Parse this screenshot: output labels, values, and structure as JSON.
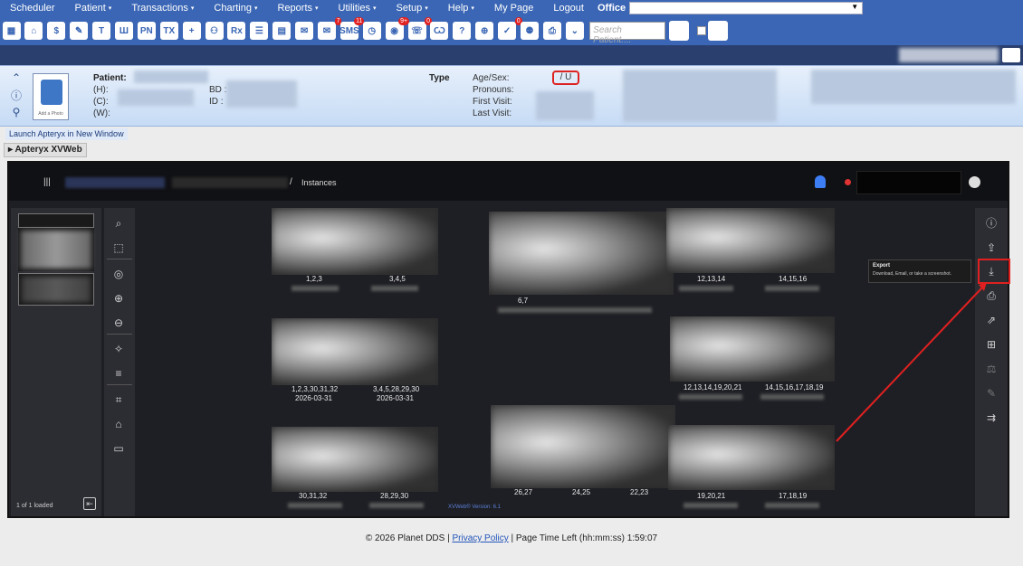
{
  "menu": {
    "items": [
      {
        "label": "Scheduler",
        "caret": ""
      },
      {
        "label": "Patient",
        "caret": "▾"
      },
      {
        "label": "Transactions",
        "caret": "▾"
      },
      {
        "label": "Charting",
        "caret": "▾"
      },
      {
        "label": "Reports",
        "caret": "▾"
      },
      {
        "label": "Utilities",
        "caret": "▾"
      },
      {
        "label": "Setup",
        "caret": "▾"
      },
      {
        "label": "Help",
        "caret": "▾"
      },
      {
        "label": "My Page",
        "caret": ""
      },
      {
        "label": "Logout",
        "caret": ""
      }
    ],
    "office_label": "Office"
  },
  "toolbar": {
    "icons": [
      {
        "name": "calendar-icon",
        "glyph": "▦",
        "badge": ""
      },
      {
        "name": "home-icon",
        "glyph": "⌂",
        "badge": ""
      },
      {
        "name": "dollar-icon",
        "glyph": "$",
        "badge": ""
      },
      {
        "name": "edit-icon",
        "glyph": "✎",
        "badge": ""
      },
      {
        "name": "tooth-icon",
        "glyph": "T",
        "badge": ""
      },
      {
        "name": "tooth-chart-icon",
        "glyph": "Ш",
        "badge": ""
      },
      {
        "name": "pn-icon",
        "glyph": "PN",
        "badge": ""
      },
      {
        "name": "tx-icon",
        "glyph": "TX",
        "badge": ""
      },
      {
        "name": "add-patient-icon",
        "glyph": "+",
        "badge": ""
      },
      {
        "name": "patients-icon",
        "glyph": "⚇",
        "badge": ""
      },
      {
        "name": "rx-icon",
        "glyph": "Rx",
        "badge": ""
      },
      {
        "name": "notes-icon",
        "glyph": "☰",
        "badge": ""
      },
      {
        "name": "document-icon",
        "glyph": "▤",
        "badge": ""
      },
      {
        "name": "mail-icon",
        "glyph": "✉",
        "badge": ""
      },
      {
        "name": "chat-icon",
        "glyph": "✉",
        "badge": "7"
      },
      {
        "name": "sms-icon",
        "glyph": "SMS",
        "badge": "11"
      },
      {
        "name": "clock-icon",
        "glyph": "◷",
        "badge": ""
      },
      {
        "name": "globe-icon",
        "glyph": "◉",
        "badge": "9+"
      },
      {
        "name": "recall-icon",
        "glyph": "☏",
        "badge": "0"
      },
      {
        "name": "tooth-outline-icon",
        "glyph": "Ѡ",
        "badge": ""
      },
      {
        "name": "question-icon",
        "glyph": "?",
        "badge": ""
      },
      {
        "name": "network-icon",
        "glyph": "⊕",
        "badge": ""
      },
      {
        "name": "tasks-icon",
        "glyph": "✓",
        "badge": "0"
      },
      {
        "name": "group-icon",
        "glyph": "⚉",
        "badge": ""
      },
      {
        "name": "printer-icon",
        "glyph": "⎙",
        "badge": ""
      },
      {
        "name": "chevron-icon",
        "glyph": "⌄",
        "badge": ""
      }
    ],
    "search_placeholder": "Search Patient...."
  },
  "patient": {
    "patient_label": "Patient:",
    "h_label": "(H):",
    "c_label": "(C):",
    "w_label": "(W):",
    "bd_label": "BD :",
    "id_label": "ID :",
    "type_label": "Type",
    "agesex_label": "Age/Sex:",
    "agesex_value": "/ U",
    "pronouns_label": "Pronouns:",
    "first_visit_label": "First Visit:",
    "last_visit_label": "Last Visit:",
    "photo_caption": "Add a Photo"
  },
  "launch_link": "Launch Apteryx in New Window",
  "section_tab": "Apteryx XVWeb",
  "viewer": {
    "breadcrumb_sep": "/",
    "breadcrumb_current": "Instances",
    "loaded_text": "1 of 1 loaded",
    "tiles": [
      {
        "labels": [
          "1,2,3",
          "3,4,5"
        ]
      },
      {
        "labels": [
          "6,7"
        ]
      },
      {
        "labels": [
          "12,13,14",
          "14,15,16"
        ]
      },
      {
        "labels": [
          "1,2,3,30,31,32",
          "3,4,5,28,29,30"
        ],
        "dates": [
          "2026-03-31",
          "2026-03-31"
        ]
      },
      {
        "labels": [
          "12,13,14,19,20,21",
          "14,15,16,17,18,19"
        ]
      },
      {
        "labels": [
          "30,31,32",
          "28,29,30"
        ]
      },
      {
        "labels": [
          "26,27",
          "24,25",
          "22,23"
        ]
      },
      {
        "labels": [
          "19,20,21",
          "17,18,19"
        ]
      }
    ],
    "tooltip_title": "Export",
    "tooltip_desc": "Download, Email, or take a screenshot.",
    "version": "XVWeb® Version: 6.1"
  },
  "footer": {
    "copyright": "© 2026 Planet DDS |",
    "privacy": "Privacy Policy",
    "time_left": "| Page Time Left (hh:mm:ss) 1:59:07"
  }
}
